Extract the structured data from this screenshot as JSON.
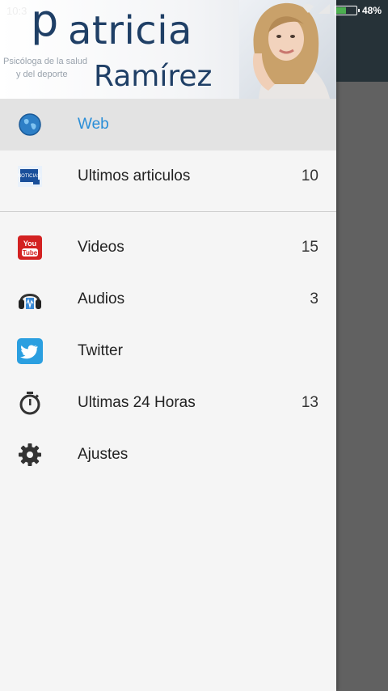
{
  "status_bar": {
    "time": "10:3",
    "battery_percent": "48%",
    "battery_level": 0.48,
    "battery_color": "#4caf50"
  },
  "header": {
    "logo_initial": "p",
    "logo_first": "atricia",
    "logo_last": "Ramírez",
    "tagline_line1": "Psicóloga de la salud",
    "tagline_line2": "y del deporte"
  },
  "menu": {
    "items": [
      {
        "label": "Web",
        "count": "",
        "icon": "globe-icon",
        "active": true
      },
      {
        "label": "Ultimos articulos",
        "count": "10",
        "icon": "news-icon"
      },
      {
        "label": "Videos",
        "count": "15",
        "icon": "youtube-icon"
      },
      {
        "label": "Audios",
        "count": "3",
        "icon": "headphones-icon"
      },
      {
        "label": "Twitter",
        "count": "",
        "icon": "twitter-icon"
      },
      {
        "label": "Ultimas 24 Horas",
        "count": "13",
        "icon": "stopwatch-icon"
      },
      {
        "label": "Ajustes",
        "count": "",
        "icon": "gear-icon"
      }
    ]
  },
  "colors": {
    "accent": "#2a8ed8",
    "brand_navy": "#1f3f66"
  }
}
